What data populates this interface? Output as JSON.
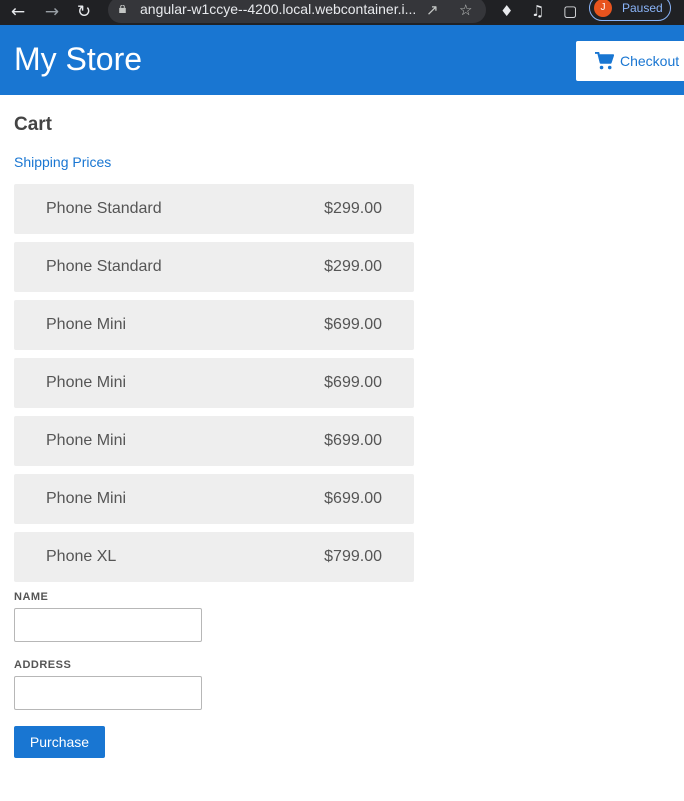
{
  "browser": {
    "url": "angular-w1ccye--4200.local.webcontainer.i...",
    "profile_initial": "J",
    "profile_status": "Paused"
  },
  "header": {
    "title": "My Store",
    "checkout_label": "Checkout"
  },
  "cart": {
    "title": "Cart",
    "shipping_link": "Shipping Prices",
    "items": [
      {
        "name": "Phone Standard",
        "price": "$299.00"
      },
      {
        "name": "Phone Standard",
        "price": "$299.00"
      },
      {
        "name": "Phone Mini",
        "price": "$699.00"
      },
      {
        "name": "Phone Mini",
        "price": "$699.00"
      },
      {
        "name": "Phone Mini",
        "price": "$699.00"
      },
      {
        "name": "Phone Mini",
        "price": "$699.00"
      },
      {
        "name": "Phone XL",
        "price": "$799.00"
      }
    ]
  },
  "form": {
    "name_label": "NAME",
    "name_value": "",
    "address_label": "ADDRESS",
    "address_value": "",
    "purchase_label": "Purchase"
  },
  "colors": {
    "primary": "#1976d2",
    "item_bg": "#eeeeee"
  }
}
